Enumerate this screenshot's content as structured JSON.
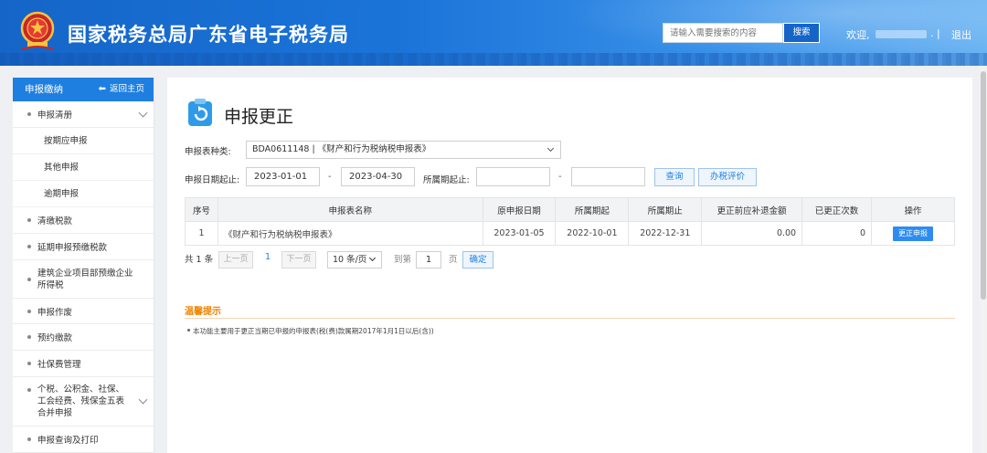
{
  "header": {
    "title": "国家税务总局广东省电子税务局",
    "search_placeholder": "请输入需要搜索的内容",
    "search_button": "搜索",
    "welcome": "欢迎,",
    "separator": ". |",
    "logout": "退出"
  },
  "sidebar": {
    "title": "申报缴纳",
    "back": "返回主页",
    "items": [
      {
        "label": "申报清册",
        "expanded": true
      },
      {
        "label": "按期应申报"
      },
      {
        "label": "其他申报"
      },
      {
        "label": "逾期申报"
      },
      {
        "label": "清缴税款"
      },
      {
        "label": "延期申报预缴税款"
      },
      {
        "label": "建筑企业项目部预缴企业所得税"
      },
      {
        "label": "申报作废"
      },
      {
        "label": "预约缴款"
      },
      {
        "label": "社保费管理"
      },
      {
        "label": "个税、公积金、社保、工会经费、残保金五表合并申报"
      },
      {
        "label": "申报查询及打印"
      }
    ]
  },
  "main": {
    "title": "申报更正",
    "form": {
      "type_label": "申报表种类:",
      "type_value": "BDA0611148 | 《财产和行为税纳税申报表》",
      "date_label": "申报日期起止:",
      "date_from": "2023-01-01",
      "date_to": "2023-04-30",
      "dash": "-",
      "period_label": "所属期起止:",
      "query_button": "查询",
      "rating_button": "办税评价"
    },
    "table": {
      "headers": [
        "序号",
        "申报表名称",
        "原申报日期",
        "所属期起",
        "所属期止",
        "更正前应补退金额",
        "已更正次数",
        "操作"
      ],
      "rows": [
        [
          "1",
          "《财产和行为税纳税申报表》",
          "2023-01-05",
          "2022-10-01",
          "2022-12-31",
          "0.00",
          "0",
          "更正申报"
        ]
      ]
    },
    "pagination": {
      "total": "共 1 条",
      "prev": "上一页",
      "current": "1",
      "next": "下一页",
      "page_size": "10 条/页",
      "goto_label": "到第",
      "goto_value": "1",
      "page_unit": "页",
      "confirm": "确定"
    },
    "tips": {
      "title": "温馨提示",
      "text": "本功能主要用于更正当期已申报的申报表(税(费)款属期2017年1月1日以后(含))"
    }
  },
  "colors": {
    "brand_blue": "#1e7fe0",
    "tips_orange": "#f08200"
  }
}
